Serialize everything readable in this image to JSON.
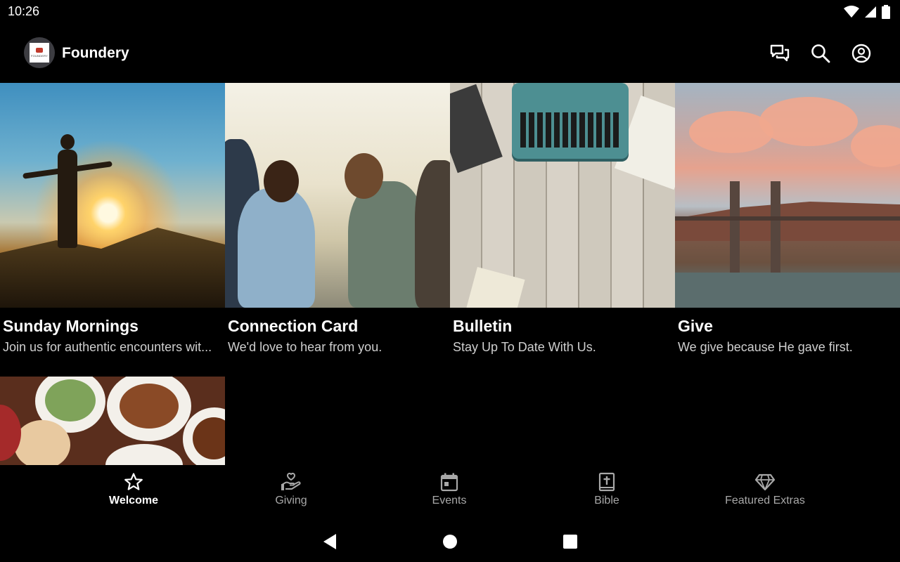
{
  "status_bar": {
    "time": "10:26",
    "icons": [
      "wifi-icon",
      "signal-icon",
      "battery-icon"
    ]
  },
  "app_bar": {
    "title": "Foundery",
    "logo_text": "FOUNDERY",
    "actions": [
      "chat-icon",
      "search-icon",
      "account-icon"
    ]
  },
  "cards": [
    {
      "title": "Sunday Mornings",
      "subtitle": "Join us for authentic encounters wit..."
    },
    {
      "title": "Connection Card",
      "subtitle": "We'd love to hear from you."
    },
    {
      "title": "Bulletin",
      "subtitle": "Stay Up To Date With Us."
    },
    {
      "title": "Give",
      "subtitle": "We give because He gave first."
    },
    {
      "title": "",
      "subtitle": ""
    }
  ],
  "bottom_nav": {
    "active": "Welcome",
    "items": [
      {
        "label": "Welcome",
        "icon": "star-icon"
      },
      {
        "label": "Giving",
        "icon": "giving-hand-icon"
      },
      {
        "label": "Events",
        "icon": "calendar-icon"
      },
      {
        "label": "Bible",
        "icon": "bible-icon"
      },
      {
        "label": "Featured Extras",
        "icon": "diamond-icon"
      }
    ]
  },
  "system_nav": [
    "back-icon",
    "home-icon",
    "recents-icon"
  ],
  "colors": {
    "background": "#000000",
    "text_primary": "#ffffff",
    "text_secondary": "#cfcfcf",
    "nav_inactive": "#a8a8a8"
  }
}
